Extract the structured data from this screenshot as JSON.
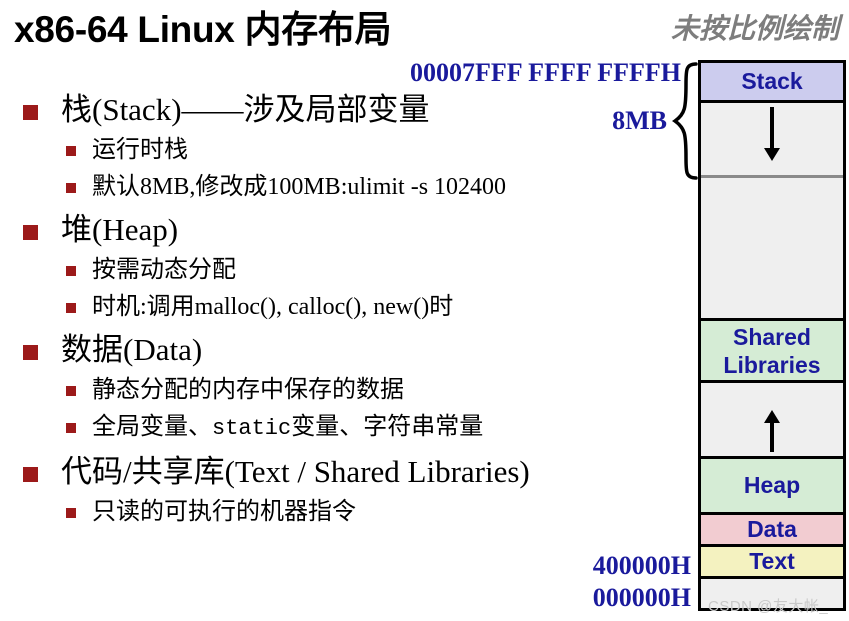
{
  "slide": {
    "title": "x86-64 Linux 内存布局",
    "note": "未按比例绘制"
  },
  "bullets": [
    {
      "text": "栈(Stack)——涉及局部变量",
      "sub": [
        "运行时栈",
        "默认8MB,修改成100MB:ulimit -s 102400"
      ]
    },
    {
      "text": "堆(Heap)",
      "sub": [
        "按需动态分配",
        "时机:调用malloc(), calloc(), new()时"
      ]
    },
    {
      "text": "数据(Data)",
      "sub": [
        "静态分配的内存中保存的数据",
        "全局变量、static变量、字符串常量"
      ]
    },
    {
      "text": "代码/共享库(Text / Shared Libraries)",
      "sub": [
        "只读的可执行的机器指令"
      ]
    }
  ],
  "data_line_parts": {
    "prefix": "全局变量、",
    "mono": "static",
    "suffix": "变量、字符串常量"
  },
  "memory_map": {
    "segments": [
      {
        "label": "Stack",
        "color": "#ccccee"
      },
      {
        "label": "",
        "color": "#efefef"
      },
      {
        "label": "",
        "color": "#efefef"
      },
      {
        "label": "Shared",
        "label2": "Libraries",
        "color": "#d5ecd5"
      },
      {
        "label": "",
        "color": "#efefef"
      },
      {
        "label": "Heap",
        "color": "#d5ecd5"
      },
      {
        "label": "Data",
        "color": "#f2ccd1"
      },
      {
        "label": "Text",
        "color": "#f4f2c0"
      },
      {
        "label": "",
        "color": "#efefef"
      }
    ],
    "shared_libraries_line1": "Shared",
    "shared_libraries_line2": "Libraries",
    "stack_label": "Stack",
    "heap_label": "Heap",
    "data_label": "Data",
    "text_label": "Text"
  },
  "addresses": {
    "top": "00007FFF FFFF FFFFH",
    "stack_size": "8MB",
    "text_start": "400000H",
    "zero": "000000H"
  },
  "colors": {
    "address_blue": "#1a1a9c",
    "bullet_red": "#9c1a1a",
    "note_gray": "#7d7d7d",
    "stack_fill": "#ccccee",
    "lib_fill": "#d5ecd5",
    "data_fill": "#f2ccd1",
    "text_fill": "#f4f2c0",
    "empty_fill": "#efefef"
  },
  "watermark": "CSDN @友大帐_"
}
